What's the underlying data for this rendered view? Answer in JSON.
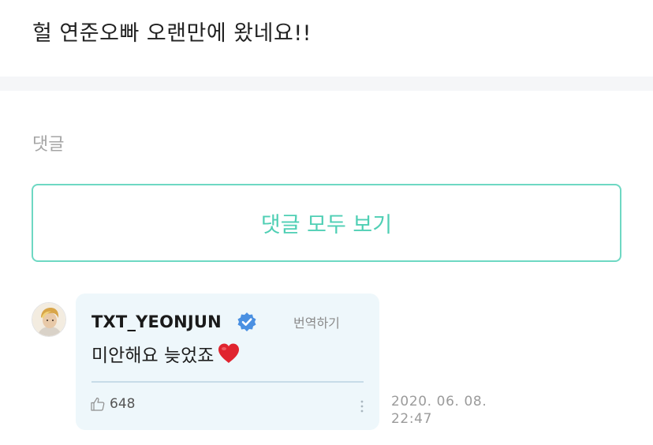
{
  "post": {
    "text": "헐 연준오빠 오랜만에 왔네요!!"
  },
  "comments_section": {
    "label": "댓글",
    "view_all_label": "댓글 모두 보기",
    "accent_color": "#4fcfb4"
  },
  "comment": {
    "author": "TXT_YEONJUN",
    "verified": true,
    "verified_icon": "verified-badge-icon",
    "translate_label": "번역하기",
    "body": "미안해요 늦었죠",
    "emoji": "heart-emoji-icon",
    "like_icon": "thumbs-up-icon",
    "like_count": "648",
    "more_icon": "more-vertical-icon",
    "timestamp": "2020. 06. 08. 22:47"
  }
}
